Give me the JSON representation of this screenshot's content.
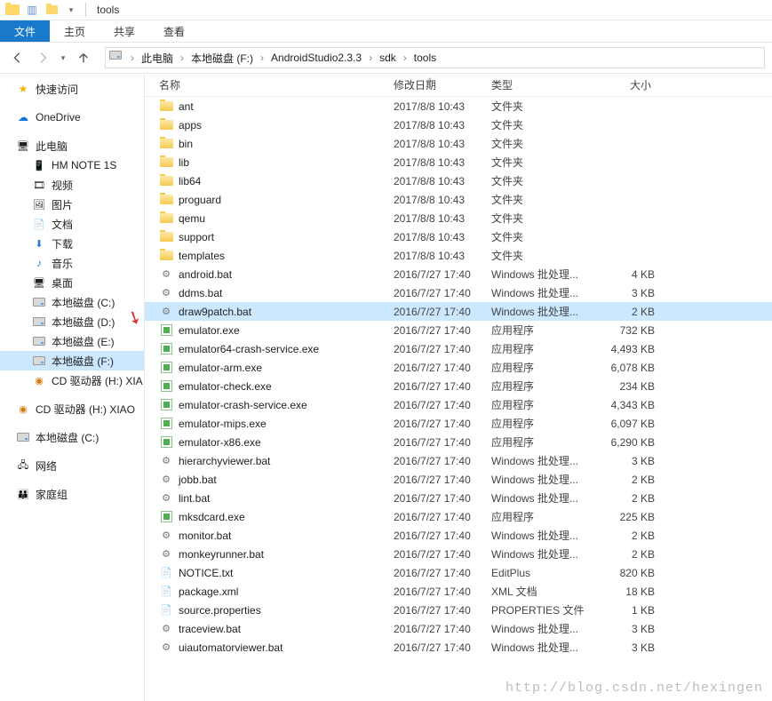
{
  "titlebar": {
    "title": "tools"
  },
  "ribbon": {
    "file": "文件",
    "home": "主页",
    "share": "共享",
    "view": "查看"
  },
  "breadcrumb": {
    "items": [
      "此电脑",
      "本地磁盘 (F:)",
      "AndroidStudio2.3.3",
      "sdk",
      "tools"
    ]
  },
  "sidebar": {
    "quick": "快速访问",
    "onedrive": "OneDrive",
    "thispc": "此电脑",
    "items": [
      "HM NOTE 1S",
      "视频",
      "图片",
      "文档",
      "下载",
      "音乐",
      "桌面",
      "本地磁盘 (C:)",
      "本地磁盘 (D:)",
      "本地磁盘 (E:)",
      "本地磁盘 (F:)",
      "CD 驱动器 (H:) XIA"
    ],
    "extra_cd": "CD 驱动器 (H:) XIAO",
    "extra_drive": "本地磁盘 (C:)",
    "network": "网络",
    "homegroup": "家庭组"
  },
  "columns": {
    "name": "名称",
    "date": "修改日期",
    "type": "类型",
    "size": "大小"
  },
  "files": [
    {
      "icon": "folder",
      "name": "ant",
      "date": "2017/8/8 10:43",
      "type": "文件夹",
      "size": ""
    },
    {
      "icon": "folder",
      "name": "apps",
      "date": "2017/8/8 10:43",
      "type": "文件夹",
      "size": ""
    },
    {
      "icon": "folder",
      "name": "bin",
      "date": "2017/8/8 10:43",
      "type": "文件夹",
      "size": ""
    },
    {
      "icon": "folder",
      "name": "lib",
      "date": "2017/8/8 10:43",
      "type": "文件夹",
      "size": ""
    },
    {
      "icon": "folder",
      "name": "lib64",
      "date": "2017/8/8 10:43",
      "type": "文件夹",
      "size": ""
    },
    {
      "icon": "folder",
      "name": "proguard",
      "date": "2017/8/8 10:43",
      "type": "文件夹",
      "size": ""
    },
    {
      "icon": "folder",
      "name": "qemu",
      "date": "2017/8/8 10:43",
      "type": "文件夹",
      "size": ""
    },
    {
      "icon": "folder",
      "name": "support",
      "date": "2017/8/8 10:43",
      "type": "文件夹",
      "size": ""
    },
    {
      "icon": "folder",
      "name": "templates",
      "date": "2017/8/8 10:43",
      "type": "文件夹",
      "size": ""
    },
    {
      "icon": "bat",
      "name": "android.bat",
      "date": "2016/7/27 17:40",
      "type": "Windows 批处理...",
      "size": "4 KB"
    },
    {
      "icon": "bat",
      "name": "ddms.bat",
      "date": "2016/7/27 17:40",
      "type": "Windows 批处理...",
      "size": "3 KB"
    },
    {
      "icon": "bat",
      "name": "draw9patch.bat",
      "date": "2016/7/27 17:40",
      "type": "Windows 批处理...",
      "size": "2 KB",
      "selected": true
    },
    {
      "icon": "exe",
      "name": "emulator.exe",
      "date": "2016/7/27 17:40",
      "type": "应用程序",
      "size": "732 KB"
    },
    {
      "icon": "exe",
      "name": "emulator64-crash-service.exe",
      "date": "2016/7/27 17:40",
      "type": "应用程序",
      "size": "4,493 KB"
    },
    {
      "icon": "exe",
      "name": "emulator-arm.exe",
      "date": "2016/7/27 17:40",
      "type": "应用程序",
      "size": "6,078 KB"
    },
    {
      "icon": "exe",
      "name": "emulator-check.exe",
      "date": "2016/7/27 17:40",
      "type": "应用程序",
      "size": "234 KB"
    },
    {
      "icon": "exe",
      "name": "emulator-crash-service.exe",
      "date": "2016/7/27 17:40",
      "type": "应用程序",
      "size": "4,343 KB"
    },
    {
      "icon": "exe",
      "name": "emulator-mips.exe",
      "date": "2016/7/27 17:40",
      "type": "应用程序",
      "size": "6,097 KB"
    },
    {
      "icon": "exe",
      "name": "emulator-x86.exe",
      "date": "2016/7/27 17:40",
      "type": "应用程序",
      "size": "6,290 KB"
    },
    {
      "icon": "bat",
      "name": "hierarchyviewer.bat",
      "date": "2016/7/27 17:40",
      "type": "Windows 批处理...",
      "size": "3 KB"
    },
    {
      "icon": "bat",
      "name": "jobb.bat",
      "date": "2016/7/27 17:40",
      "type": "Windows 批处理...",
      "size": "2 KB"
    },
    {
      "icon": "bat",
      "name": "lint.bat",
      "date": "2016/7/27 17:40",
      "type": "Windows 批处理...",
      "size": "2 KB"
    },
    {
      "icon": "exe",
      "name": "mksdcard.exe",
      "date": "2016/7/27 17:40",
      "type": "应用程序",
      "size": "225 KB"
    },
    {
      "icon": "bat",
      "name": "monitor.bat",
      "date": "2016/7/27 17:40",
      "type": "Windows 批处理...",
      "size": "2 KB"
    },
    {
      "icon": "bat",
      "name": "monkeyrunner.bat",
      "date": "2016/7/27 17:40",
      "type": "Windows 批处理...",
      "size": "2 KB"
    },
    {
      "icon": "txt",
      "name": "NOTICE.txt",
      "date": "2016/7/27 17:40",
      "type": "EditPlus",
      "size": "820 KB"
    },
    {
      "icon": "xml",
      "name": "package.xml",
      "date": "2016/7/27 17:40",
      "type": "XML 文档",
      "size": "18 KB"
    },
    {
      "icon": "prop",
      "name": "source.properties",
      "date": "2016/7/27 17:40",
      "type": "PROPERTIES 文件",
      "size": "1 KB"
    },
    {
      "icon": "bat",
      "name": "traceview.bat",
      "date": "2016/7/27 17:40",
      "type": "Windows 批处理...",
      "size": "3 KB"
    },
    {
      "icon": "bat",
      "name": "uiautomatorviewer.bat",
      "date": "2016/7/27 17:40",
      "type": "Windows 批处理...",
      "size": "3 KB"
    }
  ],
  "watermark": "http://blog.csdn.net/hexingen"
}
